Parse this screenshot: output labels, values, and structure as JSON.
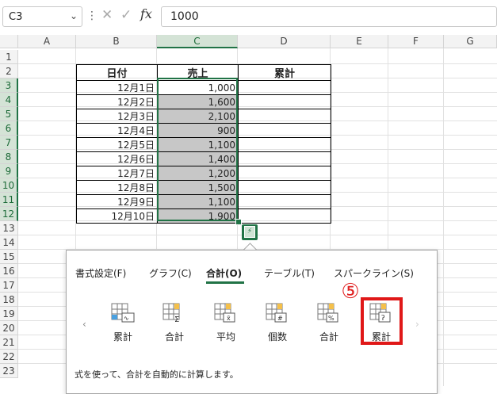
{
  "name_box": {
    "value": "C3",
    "arrow": "⌄"
  },
  "formula_bar": {
    "dots": "⋮",
    "cancel": "✕",
    "enter": "✓",
    "fx": "fx",
    "value": "1000"
  },
  "columns": [
    "A",
    "B",
    "C",
    "D",
    "E",
    "F",
    "G"
  ],
  "rows": [
    "1",
    "2",
    "3",
    "4",
    "5",
    "6",
    "7",
    "8",
    "9",
    "10",
    "11",
    "12",
    "13",
    "14",
    "15",
    "16",
    "17",
    "18",
    "19",
    "20",
    "21",
    "22",
    "23"
  ],
  "table": {
    "headers": [
      "日付",
      "売上",
      "累計"
    ],
    "rows": [
      {
        "date": "12月1日",
        "sales": "1,000",
        "total": ""
      },
      {
        "date": "12月2日",
        "sales": "1,600",
        "total": ""
      },
      {
        "date": "12月3日",
        "sales": "2,100",
        "total": ""
      },
      {
        "date": "12月4日",
        "sales": "900",
        "total": ""
      },
      {
        "date": "12月5日",
        "sales": "1,100",
        "total": ""
      },
      {
        "date": "12月6日",
        "sales": "1,400",
        "total": ""
      },
      {
        "date": "12月7日",
        "sales": "1,200",
        "total": ""
      },
      {
        "date": "12月8日",
        "sales": "1,500",
        "total": ""
      },
      {
        "date": "12月9日",
        "sales": "1,100",
        "total": ""
      },
      {
        "date": "12月10日",
        "sales": "1,900",
        "total": ""
      }
    ]
  },
  "quick_analysis": {
    "tabs": [
      "書式設定(F)",
      "グラフ(C)",
      "合計(O)",
      "テーブル(T)",
      "スパークライン(S)"
    ],
    "active_tab": "合計(O)",
    "step_marker": "⑤",
    "nav_left": "‹",
    "nav_right": "›",
    "items": [
      {
        "label": "累計",
        "icon": "running-total-rows-icon"
      },
      {
        "label": "合計",
        "icon": "sum-icon"
      },
      {
        "label": "平均",
        "icon": "average-icon"
      },
      {
        "label": "個数",
        "icon": "count-icon"
      },
      {
        "label": "合計",
        "icon": "percent-total-icon"
      },
      {
        "label": "累計",
        "icon": "running-total-columns-icon"
      }
    ],
    "description": "式を使って、合計を自動的に計算します。"
  },
  "colors": {
    "accent": "#217346",
    "highlight": "#e01818",
    "fill": "#c7c7c7"
  }
}
